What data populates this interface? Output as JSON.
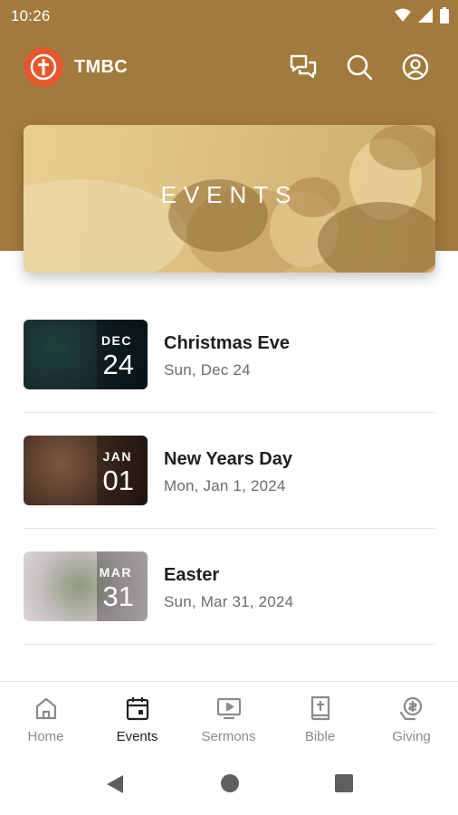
{
  "status_bar": {
    "time": "10:26",
    "icons": [
      "wifi-icon",
      "cellular-icon",
      "battery-icon"
    ]
  },
  "app_bar": {
    "title": "TMBC",
    "logo": "church-logo",
    "actions": [
      "chat-icon",
      "search-icon",
      "account-icon"
    ]
  },
  "banner": {
    "title": "EVENTS"
  },
  "events": [
    {
      "month": "DEC",
      "day": "24",
      "name": "Christmas Eve",
      "date": "Sun, Dec 24"
    },
    {
      "month": "JAN",
      "day": "01",
      "name": "New Years Day",
      "date": "Mon, Jan 1, 2024"
    },
    {
      "month": "MAR",
      "day": "31",
      "name": "Easter",
      "date": "Sun, Mar 31, 2024"
    }
  ],
  "bottom_nav": [
    {
      "label": "Home",
      "icon": "home-icon"
    },
    {
      "label": "Events",
      "icon": "calendar-icon",
      "active": true
    },
    {
      "label": "Sermons",
      "icon": "video-icon"
    },
    {
      "label": "Bible",
      "icon": "bible-icon"
    },
    {
      "label": "Giving",
      "icon": "giving-icon"
    }
  ],
  "colors": {
    "header": "#a17a3d",
    "logo": "#e5572d",
    "accent_text": "#1f1f1f",
    "muted_text": "#8a8a8a"
  }
}
